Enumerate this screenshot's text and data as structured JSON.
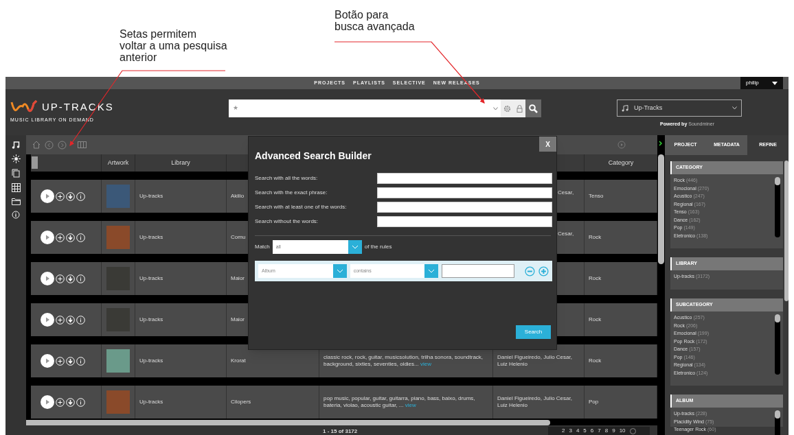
{
  "annotations": [
    {
      "text": "Setas permitem\nvoltar a uma pesquisa\nanterior"
    },
    {
      "text": "Botão para\nbusca avançada"
    }
  ],
  "top_nav": {
    "links": [
      "PROJECTS",
      "PLAYLISTS",
      "SELECTIVE",
      "NEW RELEASES"
    ],
    "user": "philip"
  },
  "header": {
    "logo_title": "UP-TRACKS",
    "logo_subtitle": "MUSIC LIBRARY ON DEMAND",
    "search_star": "★",
    "library_select": "Up-Tracks",
    "powered_by": "**Powered by** Soundminer"
  },
  "table": {
    "column_headers": [
      "Artwork",
      "Library",
      "Category"
    ],
    "rows": [
      {
        "library": "Up-tracks",
        "title": "Akilio",
        "composer": "Cesar,",
        "category": "Tenso"
      },
      {
        "library": "Up-tracks",
        "title": "Comu",
        "composer": "Cesar,",
        "category": "Rock"
      },
      {
        "library": "Up-tracks",
        "title": "Maior",
        "category": "Rock"
      },
      {
        "library": "Up-tracks",
        "title": "Maior",
        "category": "Rock"
      },
      {
        "library": "Up-tracks",
        "title": "Krorat",
        "description": "classic rock, rock, guitar, musicsolution, trilha sonora, soundtrack, background, sixties, seventies, oldies...",
        "link": "view",
        "composer": "Daniel Figueiredo, Julio Cesar, Luiz Helenio",
        "category": "Rock"
      },
      {
        "library": "Up-tracks",
        "title": "Cilopers",
        "description": "pop music, popular, guitar, guitarra, piano, bass, baixo, drums, bateria, violao, acoustic guitar, ...",
        "link": "view",
        "composer": "Daniel Figueiredo, Julio Cesar, Luiz Helenio",
        "category": "Pop"
      }
    ],
    "pagination": {
      "summary": "1 - 15 of 3172",
      "pages": [
        "2",
        "3",
        "4",
        "5",
        "6",
        "7",
        "8",
        "9",
        "10"
      ]
    }
  },
  "modal": {
    "title": "Advanced Search Builder",
    "close": "X",
    "fields": [
      "Search with all the words:",
      "Search with the exact phrase:",
      "Search with at least one of the words:",
      "Search without the words:"
    ],
    "match_label": "Match",
    "match_value": "all",
    "match_suffix": "of the rules",
    "rule": {
      "field": "Album",
      "operator": "contains"
    },
    "search_button": "Search"
  },
  "right_panel": {
    "tabs": [
      {
        "label": "PROJECT",
        "selected": false
      },
      {
        "label": "METADATA",
        "selected": false
      },
      {
        "label": "REFINE",
        "selected": true
      }
    ],
    "sections": [
      {
        "title": "CATEGORY",
        "items": [
          {
            "name": "Rock",
            "count": "(446)"
          },
          {
            "name": "Emocional",
            "count": "(270)"
          },
          {
            "name": "Acustico",
            "count": "(247)"
          },
          {
            "name": "Regional",
            "count": "(167)"
          },
          {
            "name": "Tenso",
            "count": "(163)"
          },
          {
            "name": "Dance",
            "count": "(162)"
          },
          {
            "name": "Pop",
            "count": "(149)"
          },
          {
            "name": "Eletronico",
            "count": "(138)"
          }
        ]
      },
      {
        "title": "LIBRARY",
        "items": [
          {
            "name": "Up-tracks",
            "count": "(3172)"
          }
        ]
      },
      {
        "title": "SUBCATEGORY",
        "items": [
          {
            "name": "Acustico",
            "count": "(257)"
          },
          {
            "name": "Rock",
            "count": "(206)"
          },
          {
            "name": "Emocional",
            "count": "(199)"
          },
          {
            "name": "Pop Rock",
            "count": "(172)"
          },
          {
            "name": "Dance",
            "count": "(157)"
          },
          {
            "name": "Pop",
            "count": "(146)"
          },
          {
            "name": "Regional",
            "count": "(134)"
          },
          {
            "name": "Eletronico",
            "count": "(124)"
          }
        ]
      },
      {
        "title": "ALBUM",
        "items": [
          {
            "name": "Up-tracks",
            "count": "(228)"
          },
          {
            "name": "Placidity Wind",
            "count": "(75)"
          },
          {
            "name": "Teenager Rock",
            "count": "(60)"
          }
        ]
      }
    ]
  }
}
